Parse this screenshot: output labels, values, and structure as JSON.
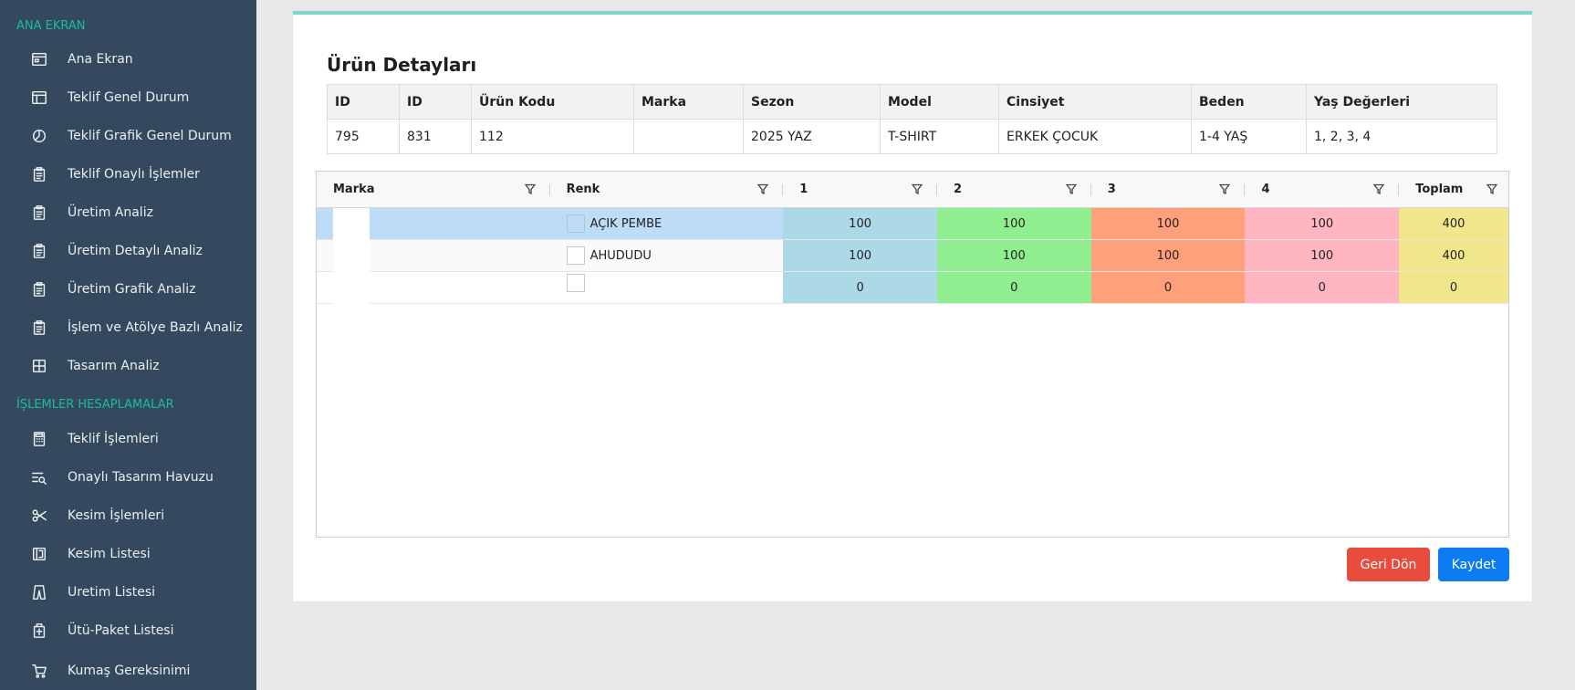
{
  "sidebar": {
    "sections": [
      {
        "title": "ANA EKRAN"
      },
      {
        "title": "İŞLEMLER HESAPLAMALAR"
      }
    ],
    "items": [
      {
        "label": "Ana Ekran",
        "icon": "window-icon"
      },
      {
        "label": "Teklif Genel Durum",
        "icon": "layout-icon"
      },
      {
        "label": "Teklif Grafik Genel Durum",
        "icon": "pie-chart-icon"
      },
      {
        "label": "Teklif Onaylı İşlemler",
        "icon": "clipboard-icon"
      },
      {
        "label": "Üretim Analiz",
        "icon": "clipboard-icon"
      },
      {
        "label": "Üretim Detaylı Analiz",
        "icon": "clipboard-icon"
      },
      {
        "label": "Üretim Grafik Analiz",
        "icon": "clipboard-icon"
      },
      {
        "label": "İşlem ve Atölye Bazlı Analiz",
        "icon": "clipboard-icon"
      },
      {
        "label": "Tasarım Analiz",
        "icon": "grid-icon"
      },
      {
        "label": "Teklif İşlemleri",
        "icon": "calculator-icon"
      },
      {
        "label": "Onaylı Tasarım Havuzu",
        "icon": "list-search-icon"
      },
      {
        "label": "Kesim İşlemleri",
        "icon": "scissors-icon"
      },
      {
        "label": "Kesim Listesi",
        "icon": "pattern-icon"
      },
      {
        "label": "Uretim Listesi",
        "icon": "trousers-icon"
      },
      {
        "label": "Ütü-Paket Listesi",
        "icon": "package-icon"
      },
      {
        "label": "Kumaş Gereksinimi",
        "icon": "cart-icon"
      }
    ]
  },
  "card": {
    "title": "Ürün Detayları"
  },
  "detail_table": {
    "headers": [
      "ID",
      "ID",
      "Ürün Kodu",
      "Marka",
      "Sezon",
      "Model",
      "Cinsiyet",
      "Beden",
      "Yaş Değerleri"
    ],
    "row": [
      "795",
      "831",
      "112",
      "",
      "2025 YAZ",
      "T-SHIRT",
      "ERKEK ÇOCUK",
      "1-4 YAŞ",
      "1, 2, 3, 4"
    ]
  },
  "grid": {
    "headers": [
      "Marka",
      "Renk",
      "1",
      "2",
      "3",
      "4",
      "Toplam"
    ],
    "rows": [
      {
        "renk": "AÇIK PEMBE",
        "v1": "100",
        "v2": "100",
        "v3": "100",
        "v4": "100",
        "toplam": "400"
      },
      {
        "renk": "AHUDUDU",
        "v1": "100",
        "v2": "100",
        "v3": "100",
        "v4": "100",
        "toplam": "400"
      },
      {
        "renk": "",
        "v1": "0",
        "v2": "0",
        "v3": "0",
        "v4": "0",
        "toplam": "0"
      }
    ],
    "colors": {
      "c1": "#add8e6",
      "c2": "#90ee90",
      "c3": "#ffa07a",
      "c4": "#ffb6c1",
      "toplam": "#f0e68c",
      "selected": "#bedcf5"
    }
  },
  "buttons": {
    "back_label": "Geri Dön",
    "save_label": "Kaydet"
  }
}
